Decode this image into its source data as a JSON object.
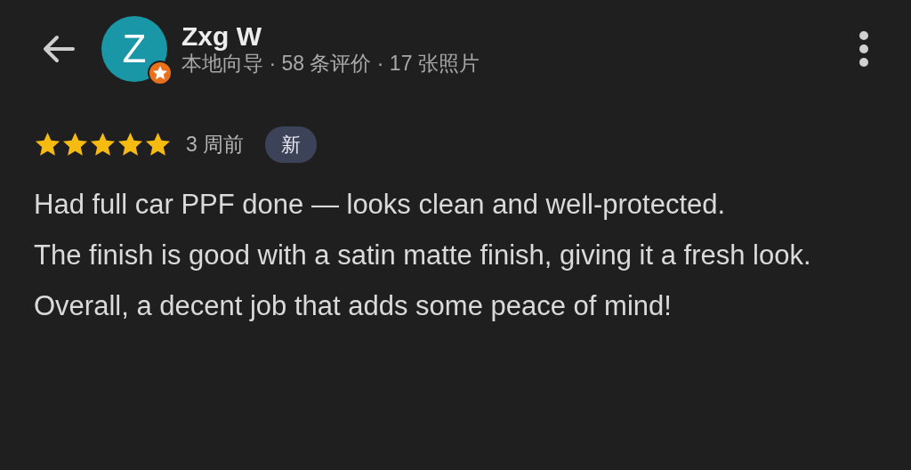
{
  "reviewer": {
    "avatar_letter": "Z",
    "local_guide": true,
    "name": "Zxg W",
    "subtitle": "本地向导 · 58 条评价 · 17 张照片"
  },
  "review": {
    "stars": 5,
    "time": "3 周前",
    "badge": "新",
    "paragraphs": [
      "Had full car PPF done — looks clean and well-protected.",
      "The finish is good with a satin matte finish, giving it a fresh look.",
      "Overall, a decent job that adds some peace of mind!"
    ]
  }
}
